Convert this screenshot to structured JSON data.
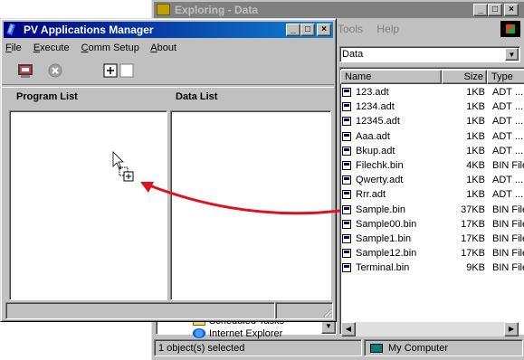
{
  "explorer": {
    "title": "Exploring - Data",
    "menu": [
      "Tools",
      "Help"
    ],
    "address": "Data",
    "tree": [
      "Scheduled Tasks",
      "Internet Explorer"
    ],
    "columns": {
      "name": "Name",
      "size": "Size",
      "type": "Type"
    },
    "files": [
      {
        "name": "123.adt",
        "size": "1KB",
        "type": "ADT ..."
      },
      {
        "name": "1234.adt",
        "size": "1KB",
        "type": "ADT ..."
      },
      {
        "name": "12345.adt",
        "size": "1KB",
        "type": "ADT ..."
      },
      {
        "name": "Aaa.adt",
        "size": "1KB",
        "type": "ADT ..."
      },
      {
        "name": "Bkup.adt",
        "size": "1KB",
        "type": "ADT ..."
      },
      {
        "name": "Filechk.bin",
        "size": "4KB",
        "type": "BIN File"
      },
      {
        "name": "Qwerty.adt",
        "size": "1KB",
        "type": "ADT ..."
      },
      {
        "name": "Rrr.adt",
        "size": "1KB",
        "type": "ADT ..."
      },
      {
        "name": "Sample.bin",
        "size": "37KB",
        "type": "BIN File"
      },
      {
        "name": "Sample00.bin",
        "size": "17KB",
        "type": "BIN File"
      },
      {
        "name": "Sample1.bin",
        "size": "17KB",
        "type": "BIN File"
      },
      {
        "name": "Sample12.bin",
        "size": "17KB",
        "type": "BIN File"
      },
      {
        "name": "Terminal.bin",
        "size": "9KB",
        "type": "BIN File"
      }
    ],
    "status_left": "1 object(s) selected",
    "status_right": "My Computer"
  },
  "pv": {
    "title": "PV Applications Manager",
    "menu": [
      {
        "key": "F",
        "rest": "ile"
      },
      {
        "key": "E",
        "rest": "xecute"
      },
      {
        "key": "C",
        "rest": "omm Setup"
      },
      {
        "key": "A",
        "rest": "bout"
      }
    ],
    "program_list": "Program List",
    "data_list": "Data List"
  },
  "colors": {
    "arrow": "#e01020",
    "title_active": "#000080",
    "title_inactive": "#808080"
  }
}
